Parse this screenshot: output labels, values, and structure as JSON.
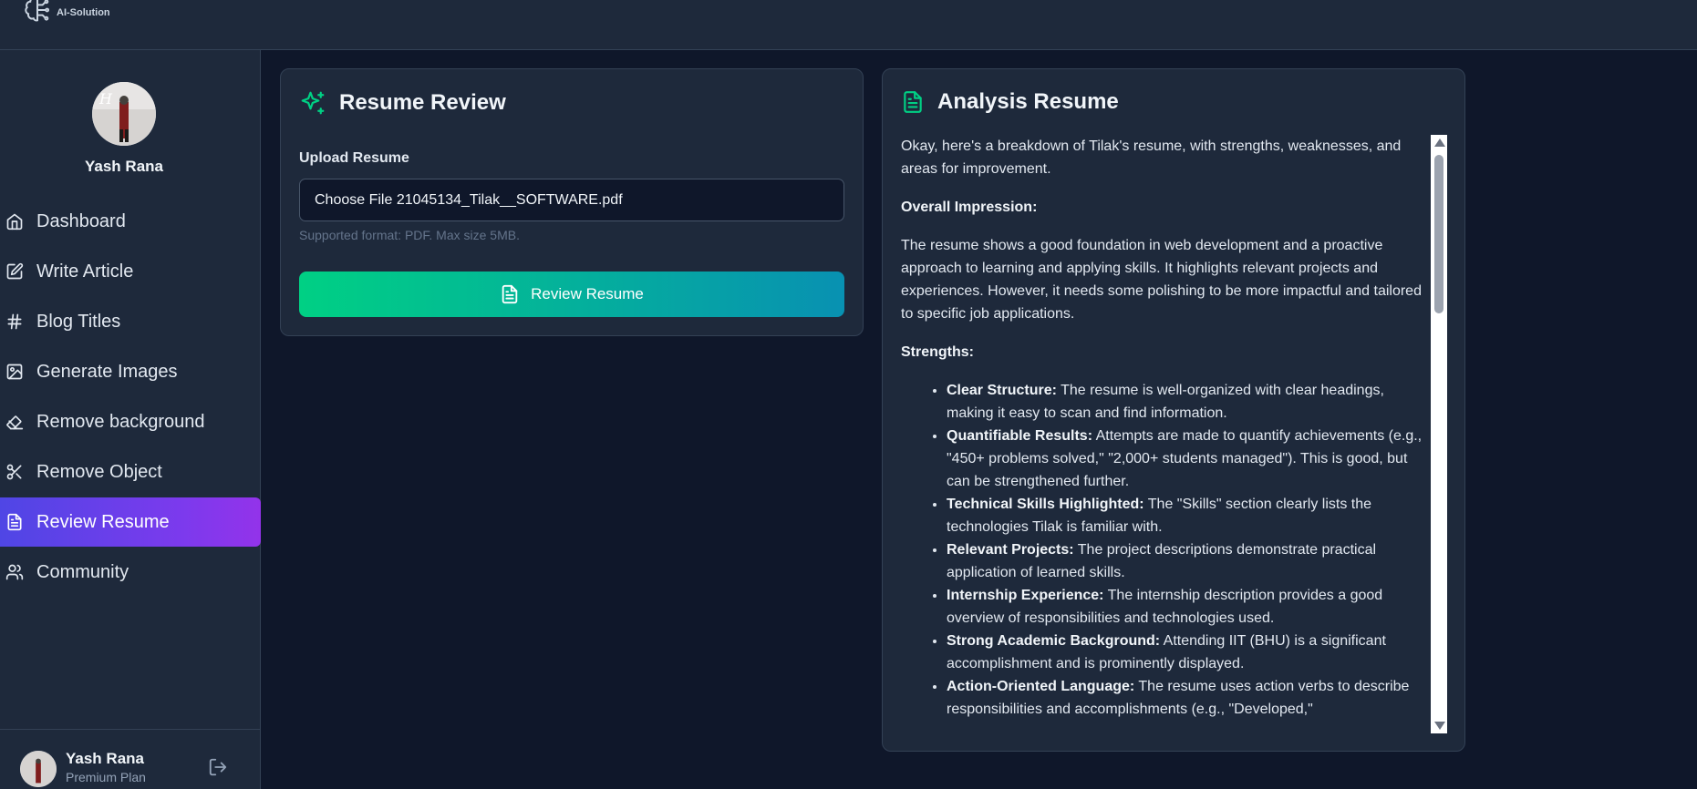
{
  "brand": {
    "name": "AI-Solution"
  },
  "profile": {
    "name": "Yash Rana"
  },
  "nav": [
    {
      "label": "Dashboard",
      "icon": "home-icon"
    },
    {
      "label": "Write Article",
      "icon": "edit-icon"
    },
    {
      "label": "Blog Titles",
      "icon": "hash-icon"
    },
    {
      "label": "Generate Images",
      "icon": "image-icon"
    },
    {
      "label": "Remove background",
      "icon": "eraser-icon"
    },
    {
      "label": "Remove Object",
      "icon": "scissors-icon"
    },
    {
      "label": "Review Resume",
      "icon": "file-text-icon",
      "active": true
    },
    {
      "label": "Community",
      "icon": "users-icon"
    }
  ],
  "footer": {
    "name": "Yash Rana",
    "plan": "Premium Plan"
  },
  "review": {
    "title": "Resume Review",
    "upload_label": "Upload Resume",
    "file_value": "Choose File 21045134_Tilak__SOFTWARE.pdf",
    "hint": "Supported format: PDF. Max size 5MB.",
    "button_label": "Review Resume"
  },
  "analysis": {
    "title": "Analysis Resume",
    "intro": "Okay, here's a breakdown of Tilak's resume, with strengths, weaknesses, and areas for improvement.",
    "overall_heading": "Overall Impression:",
    "overall_text": "The resume shows a good foundation in web development and a proactive approach to learning and applying skills. It highlights relevant projects and experiences. However, it needs some polishing to be more impactful and tailored to specific job applications.",
    "strengths_heading": "Strengths:",
    "strengths": [
      {
        "title": "Clear Structure:",
        "text": "The resume is well-organized with clear headings, making it easy to scan and find information."
      },
      {
        "title": "Quantifiable Results:",
        "text": "Attempts are made to quantify achievements (e.g., \"450+ problems solved,\" \"2,000+ students managed\"). This is good, but can be strengthened further."
      },
      {
        "title": "Technical Skills Highlighted:",
        "text": "The \"Skills\" section clearly lists the technologies Tilak is familiar with."
      },
      {
        "title": "Relevant Projects:",
        "text": "The project descriptions demonstrate practical application of learned skills."
      },
      {
        "title": "Internship Experience:",
        "text": "The internship description provides a good overview of responsibilities and technologies used."
      },
      {
        "title": "Strong Academic Background:",
        "text": "Attending IIT (BHU) is a significant accomplishment and is prominently displayed."
      },
      {
        "title": "Action-Oriented Language:",
        "text": "The resume uses action verbs to describe responsibilities and accomplishments (e.g., \"Developed,\""
      }
    ]
  }
}
